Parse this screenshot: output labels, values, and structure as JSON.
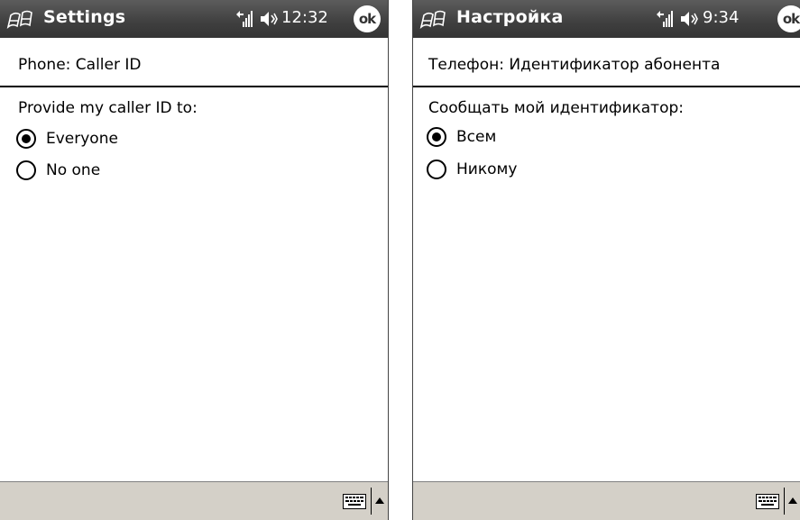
{
  "screens": [
    {
      "app_title": "Settings",
      "clock": "12:32",
      "ok_label": "ok",
      "page_title": "Phone: Caller ID",
      "prompt": "Provide my caller ID to:",
      "options": [
        {
          "label": "Everyone",
          "selected": true
        },
        {
          "label": "No one",
          "selected": false
        }
      ]
    },
    {
      "app_title": "Настройка",
      "clock": "9:34",
      "ok_label": "ok",
      "page_title": "Телефон: Идентификатор абонента",
      "prompt": "Сообщать мой идентификатор:",
      "options": [
        {
          "label": "Всем",
          "selected": true
        },
        {
          "label": "Никому",
          "selected": false
        }
      ]
    }
  ],
  "icons": {
    "start": "windows-flag-icon",
    "signal": "signal-strength-icon",
    "volume": "speaker-icon",
    "keyboard": "keyboard-icon",
    "sip_menu": "up-arrow-icon"
  },
  "colors": {
    "titlebar": "#3f3f3f",
    "bottombar": "#d4d0c8"
  }
}
